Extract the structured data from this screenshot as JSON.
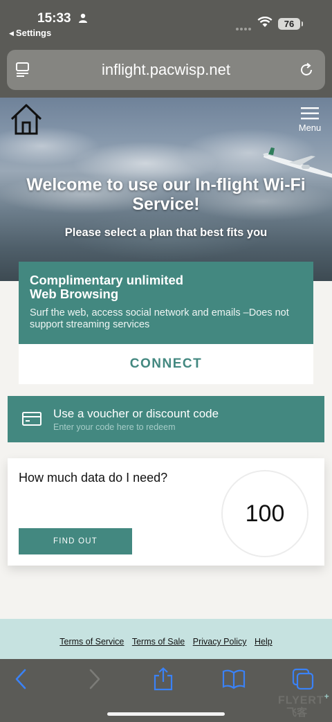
{
  "status": {
    "time": "15:33",
    "back_label": "Settings",
    "battery": "76"
  },
  "browser": {
    "url": "inflight.pacwisp.net"
  },
  "hero": {
    "menu_label": "Menu",
    "title": "Welcome to use our In-flight Wi-Fi Service!",
    "subtitle": "Please select a plan that best fits you"
  },
  "plan": {
    "title_line1": "Complimentary unlimited",
    "title_line2": "Web Browsing",
    "description": "Surf the web, access social network and emails –Does not support streaming services",
    "connect_label": "CONNECT"
  },
  "voucher": {
    "title": "Use a voucher or discount code",
    "subtitle": "Enter your code here to redeem"
  },
  "data_card": {
    "question": "How much data do I need?",
    "button_label": "FIND OUT",
    "gauge_value": "100"
  },
  "footer": {
    "links": [
      "Terms of Service",
      "Terms of Sale",
      "Privacy Policy",
      "Help"
    ]
  },
  "watermark": {
    "text": "FLYERT",
    "plus": "+",
    "cn": "飞客"
  },
  "colors": {
    "accent": "#438880",
    "footer_bg": "#c6e2e0",
    "chrome": "#5b5b57",
    "ios_blue": "#3a82f7"
  }
}
